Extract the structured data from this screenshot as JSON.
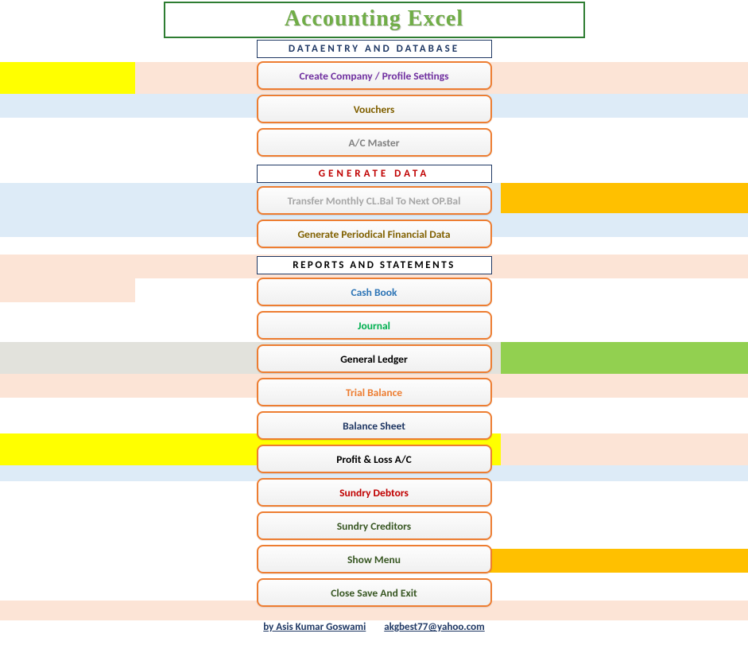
{
  "title": "Accounting Excel",
  "sections": {
    "dataentry": {
      "header": "DATAENTRY AND DATABASE",
      "buttons": [
        {
          "label": "Create Company / Profile Settings",
          "colorClass": "c-purple"
        },
        {
          "label": "Vouchers",
          "colorClass": "c-olive"
        },
        {
          "label": "A/C  Master",
          "colorClass": "c-gray"
        }
      ]
    },
    "generate": {
      "header": "GENERATE  DATA",
      "buttons": [
        {
          "label": "Transfer Monthly  CL.Bal To Next OP.Bal",
          "colorClass": "c-lightgray"
        },
        {
          "label": "Generate Periodical Financial Data",
          "colorClass": "c-olive"
        }
      ]
    },
    "reports": {
      "header": "REPORTS  AND  STATEMENTS",
      "buttons": [
        {
          "label": "Cash Book",
          "colorClass": "c-blue"
        },
        {
          "label": "Journal",
          "colorClass": "c-green"
        },
        {
          "label": "General Ledger",
          "colorClass": "c-black"
        },
        {
          "label": "Trial Balance",
          "colorClass": "c-orange"
        },
        {
          "label": "Balance Sheet",
          "colorClass": "c-darkblue"
        },
        {
          "label": "Profit & Loss A/C",
          "colorClass": "c-black"
        },
        {
          "label": "Sundry Debtors",
          "colorClass": "c-red"
        },
        {
          "label": "Sundry Creditors",
          "colorClass": "c-green2"
        },
        {
          "label": "Show Menu",
          "colorClass": "c-green2"
        },
        {
          "label": "Close Save And Exit",
          "colorClass": "c-green2"
        }
      ]
    }
  },
  "footer": {
    "author": "by Asis Kumar Goswami",
    "email": "akgbest77@yahoo.com "
  }
}
